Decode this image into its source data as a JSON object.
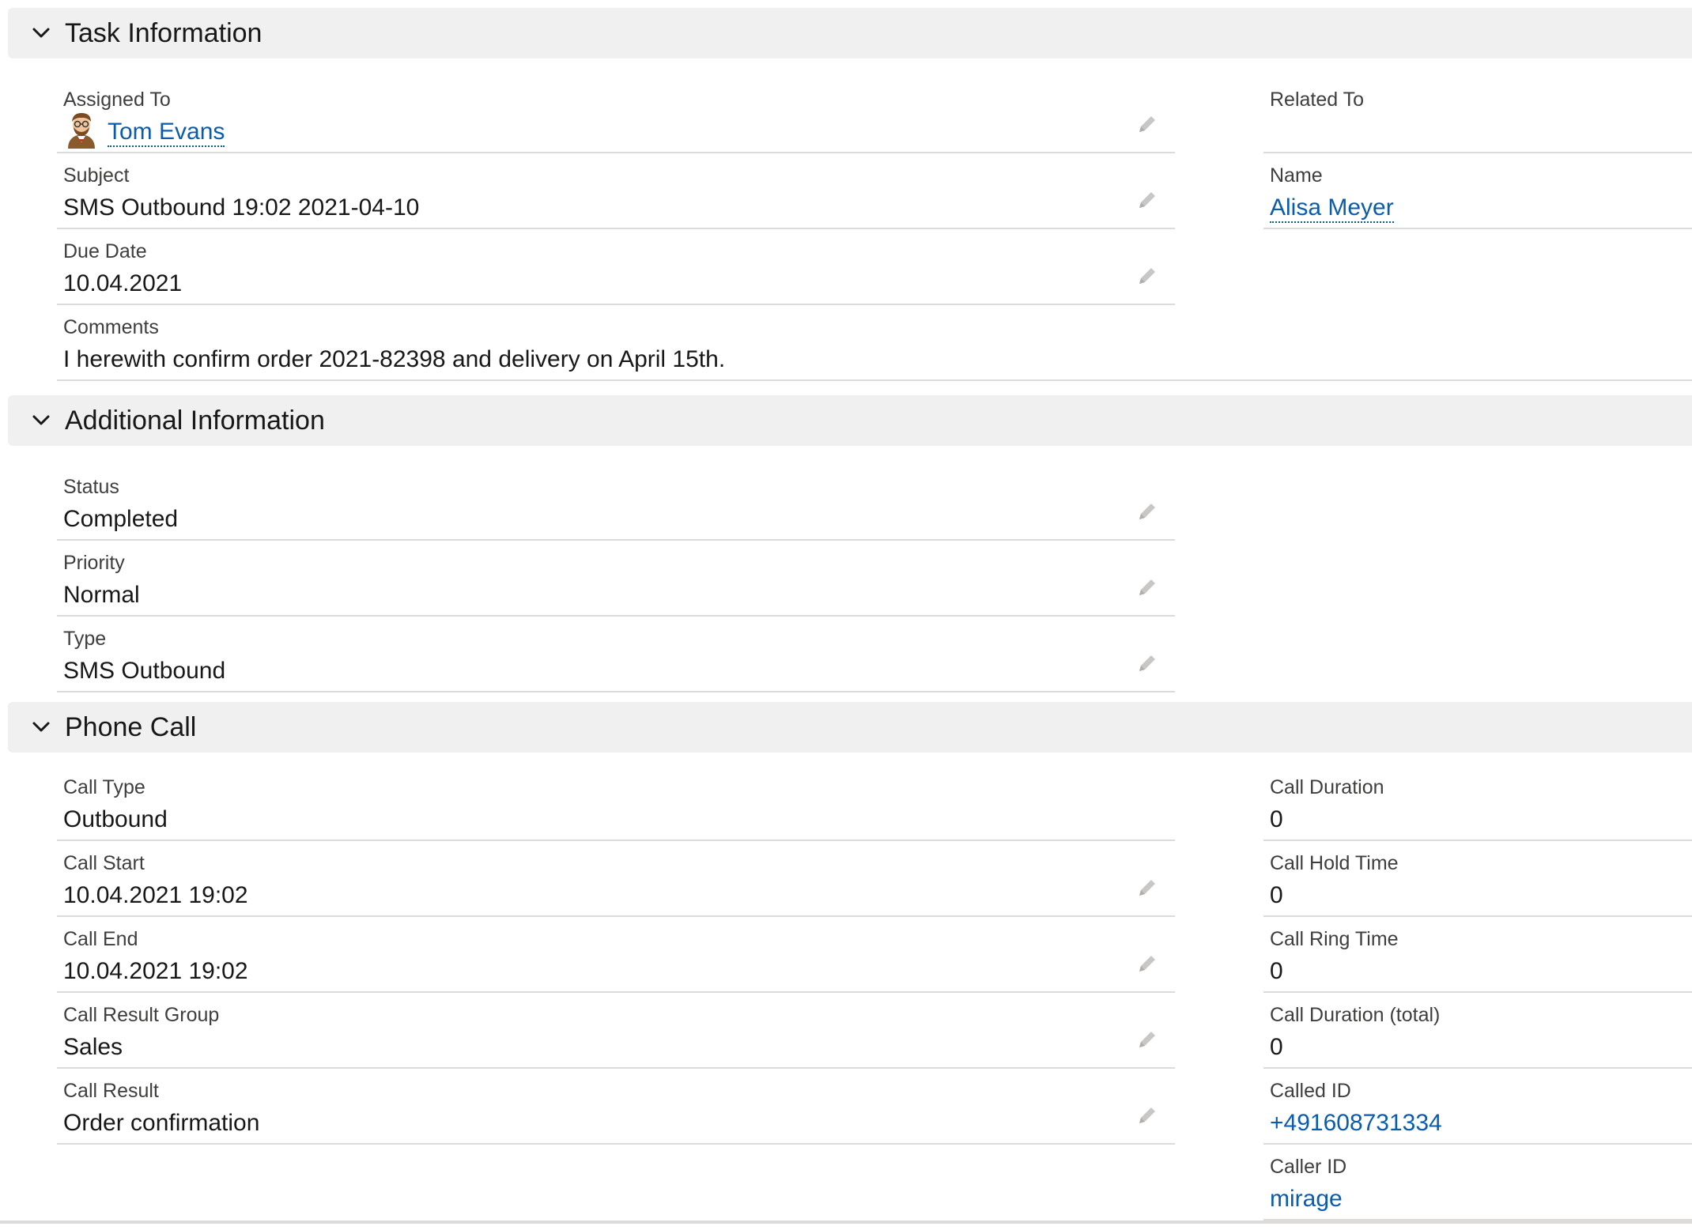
{
  "sections": {
    "task": {
      "title": "Task Information",
      "assigned_to": {
        "label": "Assigned To",
        "value": "Tom Evans"
      },
      "subject": {
        "label": "Subject",
        "value": "SMS Outbound 19:02 2021-04-10"
      },
      "due_date": {
        "label": "Due Date",
        "value": "10.04.2021"
      },
      "comments": {
        "label": "Comments",
        "value": "I herewith confirm order 2021-82398 and delivery on April 15th."
      },
      "related_to": {
        "label": "Related To",
        "value": ""
      },
      "name": {
        "label": "Name",
        "value": "Alisa Meyer"
      }
    },
    "additional": {
      "title": "Additional Information",
      "status": {
        "label": "Status",
        "value": "Completed"
      },
      "priority": {
        "label": "Priority",
        "value": "Normal"
      },
      "type": {
        "label": "Type",
        "value": "SMS Outbound"
      }
    },
    "phone": {
      "title": "Phone Call",
      "call_type": {
        "label": "Call Type",
        "value": "Outbound"
      },
      "call_start": {
        "label": "Call Start",
        "value": "10.04.2021 19:02"
      },
      "call_end": {
        "label": "Call End",
        "value": "10.04.2021 19:02"
      },
      "call_result_group": {
        "label": "Call Result Group",
        "value": "Sales"
      },
      "call_result": {
        "label": "Call Result",
        "value": "Order confirmation"
      },
      "call_duration": {
        "label": "Call Duration",
        "value": "0"
      },
      "call_hold_time": {
        "label": "Call Hold Time",
        "value": "0"
      },
      "call_ring_time": {
        "label": "Call Ring Time",
        "value": "0"
      },
      "call_duration_total": {
        "label": "Call Duration (total)",
        "value": "0"
      },
      "called_id": {
        "label": "Called ID",
        "value": "+491608731334"
      },
      "caller_id": {
        "label": "Caller ID",
        "value": "mirage"
      }
    }
  },
  "icons": {
    "section_toggle": "chevron-down-icon",
    "edit": "pencil-icon",
    "avatar": "user-avatar"
  },
  "colors": {
    "header_bg": "#f0f0f0",
    "link": "#0b5cab",
    "label": "#3e3e3c",
    "divider": "#dddbda",
    "pencil": "#c9c7c5"
  }
}
